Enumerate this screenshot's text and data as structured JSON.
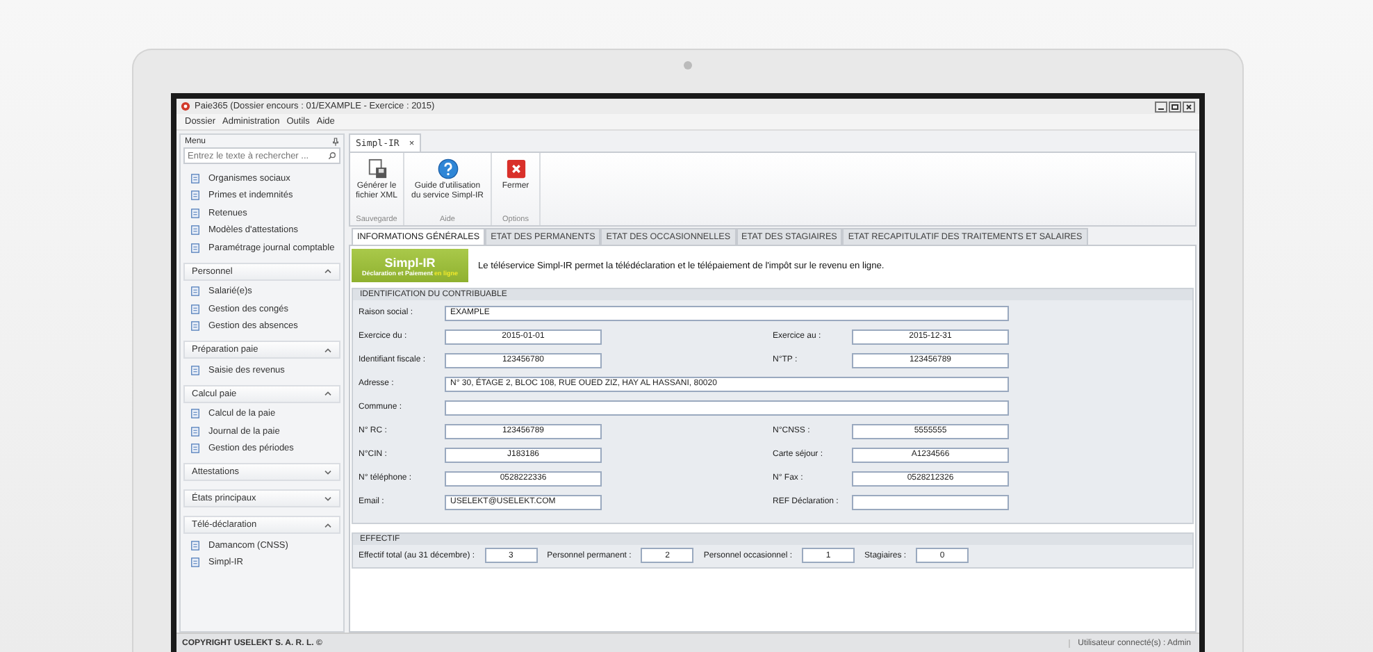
{
  "window": {
    "title": "Paie365 (Dossier encours : 01/EXAMPLE - Exercice : 2015)"
  },
  "menu_bar": [
    "Dossier",
    "Administration",
    "Outils",
    "Aide"
  ],
  "sidebar": {
    "title": "Menu",
    "search": {
      "placeholder": "Entrez le texte à rechercher ..."
    },
    "groups": [
      {
        "items": [
          "Organismes sociaux",
          "Primes et indemnités",
          "Retenues",
          "Modèles d'attestations",
          "Paramétrage journal comptable"
        ]
      },
      {
        "title": "Personnel",
        "expanded": true,
        "items": [
          "Salarié(e)s",
          "Gestion des congés",
          "Gestion des absences"
        ]
      },
      {
        "title": "Préparation paie",
        "expanded": true,
        "items": [
          "Saisie des revenus"
        ]
      },
      {
        "title": "Calcul paie",
        "expanded": true,
        "items": [
          "Calcul de la paie",
          "Journal de la paie",
          "Gestion des périodes"
        ]
      },
      {
        "title": "Attestations",
        "expanded": false
      },
      {
        "title": "États principaux",
        "expanded": false
      },
      {
        "title": "Télé-déclaration",
        "expanded": true,
        "items": [
          "Damancom (CNSS)",
          "Simpl-IR"
        ]
      }
    ]
  },
  "document_tab": {
    "label": "Simpl-IR",
    "close": "×"
  },
  "ribbon": [
    {
      "label": "Sauvegarde",
      "buttons": [
        {
          "kind": "save",
          "label": "Générer le fichier XML"
        }
      ]
    },
    {
      "label": "Aide",
      "buttons": [
        {
          "kind": "help",
          "label": "Guide d'utilisation du service Simpl-IR"
        }
      ]
    },
    {
      "label": "Options",
      "buttons": [
        {
          "kind": "close",
          "label": "Fermer"
        }
      ]
    }
  ],
  "tabs": [
    {
      "label": "INFORMATIONS GÉNÉRALES",
      "selected": true
    },
    {
      "label": "ETAT DES PERMANENTS",
      "selected": false
    },
    {
      "label": "ETAT DES OCCASIONNELLES",
      "selected": false
    },
    {
      "label": "ETAT DES STAGIAIRES",
      "selected": false
    },
    {
      "label": "ETAT RECAPITULATIF DES TRAITEMENTS ET SALAIRES",
      "selected": false
    }
  ],
  "banner": {
    "logo_title": "Simpl-IR",
    "logo_subtitle": "Déclaration et Paiement",
    "logo_highlight": "en ligne",
    "text": "Le téléservice Simpl-IR permet la télédéclaration et le télépaiement de l'impôt sur le revenu en ligne."
  },
  "identification": {
    "title": "IDENTIFICATION DU CONTRIBUABLE",
    "rows": [
      {
        "kind": "wide",
        "fields": [
          {
            "label": "Raison social :",
            "value": "EXAMPLE",
            "kind": "text"
          }
        ]
      },
      {
        "kind": "pair",
        "fields": [
          {
            "label": "Exercice du :",
            "value": "2015-01-01",
            "kind": "code"
          },
          {
            "label": "Exercice au :",
            "value": "2015-12-31",
            "kind": "code"
          }
        ]
      },
      {
        "kind": "pair",
        "fields": [
          {
            "label": "Identifiant fiscale :",
            "value": "123456780",
            "kind": "code"
          },
          {
            "label": "N°TP :",
            "value": "123456789",
            "kind": "code"
          }
        ]
      },
      {
        "kind": "wide",
        "fields": [
          {
            "label": "Adresse :",
            "value": "N° 30, ÉTAGE 2, BLOC 108, RUE OUED ZIZ, HAY AL HASSANI, 80020",
            "kind": "text"
          }
        ]
      },
      {
        "kind": "wide",
        "fields": [
          {
            "label": "Commune :",
            "kind": "text"
          }
        ]
      },
      {
        "kind": "pair",
        "fields": [
          {
            "label": "N° RC :",
            "value": "123456789",
            "kind": "code"
          },
          {
            "label": "N°CNSS :",
            "value": "5555555",
            "kind": "code"
          }
        ]
      },
      {
        "kind": "pair",
        "fields": [
          {
            "label": "N°CIN :",
            "value": "J183186",
            "kind": "code"
          },
          {
            "label": "Carte séjour :",
            "value": "A1234566",
            "kind": "code"
          }
        ]
      },
      {
        "kind": "pair",
        "fields": [
          {
            "label": "N° téléphone :",
            "value": "0528222336",
            "kind": "code"
          },
          {
            "label": "N° Fax :",
            "value": "0528212326",
            "kind": "code"
          }
        ]
      },
      {
        "kind": "pair",
        "fields": [
          {
            "label": "Email :",
            "value": "USELEKT@USELEKT.COM",
            "kind": "text"
          },
          {
            "label": "REF Déclaration :",
            "kind": "code"
          }
        ]
      }
    ]
  },
  "effectif": {
    "title": "EFFECTIF",
    "fields": [
      {
        "label": "Effectif total (au 31 décembre) :",
        "value": "3"
      },
      {
        "label": "Personnel permanent :",
        "value": "2"
      },
      {
        "label": "Personnel occasionnel :",
        "value": "1"
      },
      {
        "label": "Stagiaires :",
        "value": "0"
      }
    ]
  },
  "status_bar": {
    "copyright": "COPYRIGHT USELEKT S. A. R. L. ©",
    "user": "Utilisateur connecté(s) : Admin"
  }
}
